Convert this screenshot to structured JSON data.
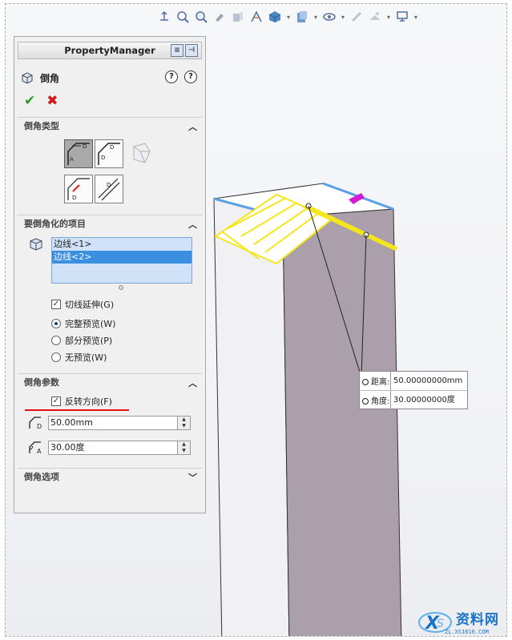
{
  "toolbar": {
    "icons": [
      "view-orientation-icon",
      "zoom-to-fit-icon",
      "zoom-area-icon",
      "previous-view-icon",
      "section-view-icon",
      "dynamic-annotation-icon",
      "view-cube-icon",
      "display-style-icon",
      "hide-show-icon",
      "edit-appearance-icon",
      "apply-scene-icon",
      "view-settings-icon",
      "monitor-icon"
    ]
  },
  "property_manager": {
    "title": "PropertyManager",
    "feature_title": "倒角",
    "help_label": "?"
  },
  "sections": {
    "chamfer_type": {
      "title": "倒角类型"
    },
    "items": {
      "title": "要倒角化的项目",
      "list": [
        "边线<1>",
        "边线<2>"
      ],
      "selected_index": 1,
      "tangent_propagation": "切线延伸(G)",
      "radios": [
        "完整预览(W)",
        "部分预览(P)",
        "无预览(W)"
      ],
      "radio_selected": 0
    },
    "params": {
      "title": "倒角参数",
      "reverse_direction": "反转方向(F)",
      "distance": "50.00mm",
      "angle": "30.00度"
    },
    "options": {
      "title": "倒角选项"
    }
  },
  "callout": {
    "distance_label": "距离:",
    "distance_value": "50.00000000mm",
    "angle_label": "角度:",
    "angle_value": "30.00000000度"
  },
  "watermark": {
    "text": "资料网",
    "sub": "ZL.XS1616.COM"
  },
  "colors": {
    "accent_blue": "#3b8fe0",
    "preview_yellow": "#ffee00",
    "part_face": "#ab9fab",
    "ok_green": "#2c9a2c",
    "cancel_red": "#d01a1a"
  }
}
